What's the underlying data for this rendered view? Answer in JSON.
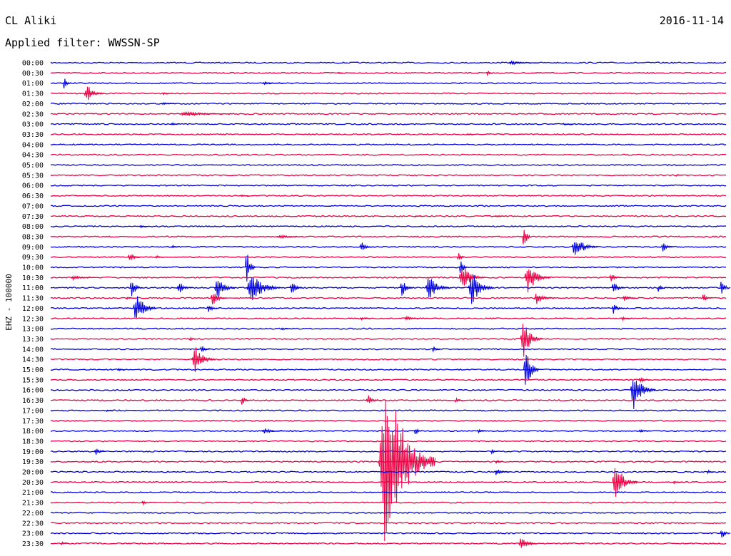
{
  "header": {
    "station": "CL Aliki",
    "date": "2016-11-14",
    "filter_label": "Applied filter: WWSSN-SP"
  },
  "chart_data": {
    "type": "line",
    "ylabel": "EHZ - 100000",
    "colors": [
      "#0000dd",
      "#ee0044"
    ],
    "x_range_minutes": [
      0,
      30
    ],
    "rows": [
      {
        "label": "00:00",
        "color": "blue",
        "events": [
          {
            "t": 20.5,
            "amp": 3,
            "dur": 1.2
          }
        ]
      },
      {
        "label": "00:30",
        "color": "red",
        "events": [
          {
            "t": 19.4,
            "amp": 6,
            "dur": 0.2
          },
          {
            "t": 12.8,
            "amp": 2,
            "dur": 0.2
          }
        ]
      },
      {
        "label": "01:00",
        "color": "blue",
        "events": [
          {
            "t": 0.6,
            "amp": 9,
            "dur": 0.3
          },
          {
            "t": 9.5,
            "amp": 3,
            "dur": 0.8
          }
        ]
      },
      {
        "label": "01:30",
        "color": "red",
        "events": [
          {
            "t": 1.6,
            "amp": 14,
            "dur": 0.8
          },
          {
            "t": 5.0,
            "amp": 2,
            "dur": 0.4
          }
        ]
      },
      {
        "label": "02:00",
        "color": "blue",
        "events": [
          {
            "t": 5.0,
            "amp": 2,
            "dur": 0.6
          }
        ]
      },
      {
        "label": "02:30",
        "color": "red",
        "events": [
          {
            "t": 6.0,
            "amp": 4,
            "dur": 2.0
          }
        ]
      },
      {
        "label": "03:00",
        "color": "blue",
        "events": [
          {
            "t": 5.4,
            "amp": 3,
            "dur": 0.3
          },
          {
            "t": 22.8,
            "amp": 2,
            "dur": 0.4
          }
        ]
      },
      {
        "label": "03:30",
        "color": "red",
        "events": [
          {
            "t": 18.5,
            "amp": 2,
            "dur": 0.3
          }
        ]
      },
      {
        "label": "04:00",
        "color": "blue",
        "events": []
      },
      {
        "label": "04:30",
        "color": "red",
        "events": []
      },
      {
        "label": "05:00",
        "color": "blue",
        "events": []
      },
      {
        "label": "05:30",
        "color": "red",
        "events": [
          {
            "t": 27.8,
            "amp": 2,
            "dur": 0.3
          }
        ]
      },
      {
        "label": "06:00",
        "color": "blue",
        "events": []
      },
      {
        "label": "06:30",
        "color": "red",
        "events": [
          {
            "t": 8.5,
            "amp": 2,
            "dur": 0.3
          }
        ]
      },
      {
        "label": "07:00",
        "color": "blue",
        "events": []
      },
      {
        "label": "07:30",
        "color": "red",
        "events": [
          {
            "t": 16.2,
            "amp": 2,
            "dur": 0.3
          },
          {
            "t": 19.8,
            "amp": 2,
            "dur": 0.4
          }
        ]
      },
      {
        "label": "08:00",
        "color": "blue",
        "events": [
          {
            "t": 4.0,
            "amp": 2,
            "dur": 0.4
          }
        ]
      },
      {
        "label": "08:30",
        "color": "red",
        "events": [
          {
            "t": 10.2,
            "amp": 3,
            "dur": 1.0
          },
          {
            "t": 21.0,
            "amp": 30,
            "dur": 0.3
          }
        ]
      },
      {
        "label": "09:00",
        "color": "blue",
        "events": [
          {
            "t": 5.4,
            "amp": 3,
            "dur": 0.3
          },
          {
            "t": 13.8,
            "amp": 8,
            "dur": 0.5
          },
          {
            "t": 23.3,
            "amp": 18,
            "dur": 1.0
          },
          {
            "t": 27.2,
            "amp": 8,
            "dur": 0.5
          }
        ]
      },
      {
        "label": "09:30",
        "color": "red",
        "events": [
          {
            "t": 3.5,
            "amp": 8,
            "dur": 0.5
          },
          {
            "t": 4.7,
            "amp": 3,
            "dur": 0.3
          },
          {
            "t": 18.1,
            "amp": 10,
            "dur": 0.3
          }
        ]
      },
      {
        "label": "10:00",
        "color": "blue",
        "events": [
          {
            "t": 8.7,
            "amp": 30,
            "dur": 0.4
          },
          {
            "t": 18.2,
            "amp": 20,
            "dur": 0.3
          }
        ]
      },
      {
        "label": "10:30",
        "color": "red",
        "events": [
          {
            "t": 1.0,
            "amp": 3,
            "dur": 1.0
          },
          {
            "t": 18.3,
            "amp": 22,
            "dur": 1.0
          },
          {
            "t": 21.2,
            "amp": 25,
            "dur": 1.0
          },
          {
            "t": 24.9,
            "amp": 8,
            "dur": 0.5
          }
        ]
      },
      {
        "label": "11:00",
        "color": "blue",
        "events": [
          {
            "t": 3.6,
            "amp": 14,
            "dur": 0.5
          },
          {
            "t": 5.7,
            "amp": 10,
            "dur": 0.6
          },
          {
            "t": 7.4,
            "amp": 18,
            "dur": 0.8
          },
          {
            "t": 8.9,
            "amp": 25,
            "dur": 1.3
          },
          {
            "t": 10.7,
            "amp": 12,
            "dur": 0.5
          },
          {
            "t": 15.6,
            "amp": 14,
            "dur": 0.5
          },
          {
            "t": 16.8,
            "amp": 18,
            "dur": 1.0
          },
          {
            "t": 18.7,
            "amp": 28,
            "dur": 1.0
          },
          {
            "t": 25.0,
            "amp": 10,
            "dur": 0.5
          },
          {
            "t": 27.0,
            "amp": 8,
            "dur": 0.3
          },
          {
            "t": 29.8,
            "amp": 14,
            "dur": 0.4
          }
        ]
      },
      {
        "label": "11:30",
        "color": "red",
        "events": [
          {
            "t": 3.4,
            "amp": 3,
            "dur": 0.3
          },
          {
            "t": 7.2,
            "amp": 12,
            "dur": 0.6
          },
          {
            "t": 21.6,
            "amp": 10,
            "dur": 0.8
          },
          {
            "t": 25.5,
            "amp": 6,
            "dur": 0.5
          },
          {
            "t": 29.0,
            "amp": 8,
            "dur": 0.4
          }
        ]
      },
      {
        "label": "12:00",
        "color": "blue",
        "events": [
          {
            "t": 3.8,
            "amp": 24,
            "dur": 0.9
          },
          {
            "t": 7.0,
            "amp": 10,
            "dur": 0.4
          },
          {
            "t": 25.0,
            "amp": 8,
            "dur": 0.5
          }
        ]
      },
      {
        "label": "12:30",
        "color": "red",
        "events": [
          {
            "t": 13.8,
            "amp": 3,
            "dur": 0.4
          },
          {
            "t": 15.8,
            "amp": 4,
            "dur": 0.6
          },
          {
            "t": 25.4,
            "amp": 4,
            "dur": 0.4
          }
        ]
      },
      {
        "label": "13:00",
        "color": "blue",
        "events": [
          {
            "t": 10.3,
            "amp": 3,
            "dur": 0.4
          }
        ]
      },
      {
        "label": "13:30",
        "color": "red",
        "events": [
          {
            "t": 6.2,
            "amp": 3,
            "dur": 0.3
          },
          {
            "t": 21.0,
            "amp": 28,
            "dur": 0.9
          }
        ]
      },
      {
        "label": "14:00",
        "color": "blue",
        "events": [
          {
            "t": 6.7,
            "amp": 6,
            "dur": 0.4
          },
          {
            "t": 17.0,
            "amp": 5,
            "dur": 0.3
          }
        ]
      },
      {
        "label": "14:30",
        "color": "red",
        "events": [
          {
            "t": 6.4,
            "amp": 22,
            "dur": 0.9
          }
        ]
      },
      {
        "label": "15:00",
        "color": "blue",
        "events": [
          {
            "t": 3.0,
            "amp": 3,
            "dur": 0.3
          },
          {
            "t": 21.1,
            "amp": 35,
            "dur": 0.6
          }
        ]
      },
      {
        "label": "15:30",
        "color": "red",
        "events": [
          {
            "t": 26.2,
            "amp": 5,
            "dur": 0.5
          }
        ]
      },
      {
        "label": "16:00",
        "color": "blue",
        "events": [
          {
            "t": 25.9,
            "amp": 30,
            "dur": 1.0
          }
        ]
      },
      {
        "label": "16:30",
        "color": "red",
        "events": [
          {
            "t": 8.5,
            "amp": 10,
            "dur": 0.3
          },
          {
            "t": 14.1,
            "amp": 8,
            "dur": 0.6
          },
          {
            "t": 18.0,
            "amp": 4,
            "dur": 0.3
          }
        ]
      },
      {
        "label": "17:00",
        "color": "blue",
        "events": [
          {
            "t": 2.5,
            "amp": 2,
            "dur": 0.3
          }
        ]
      },
      {
        "label": "17:30",
        "color": "red",
        "events": []
      },
      {
        "label": "18:00",
        "color": "blue",
        "events": [
          {
            "t": 9.5,
            "amp": 4,
            "dur": 0.8
          },
          {
            "t": 16.2,
            "amp": 8,
            "dur": 0.3
          },
          {
            "t": 19.0,
            "amp": 3,
            "dur": 0.4
          },
          {
            "t": 26.2,
            "amp": 3,
            "dur": 0.4
          }
        ]
      },
      {
        "label": "18:30",
        "color": "red",
        "events": []
      },
      {
        "label": "19:00",
        "color": "blue",
        "events": [
          {
            "t": 2.0,
            "amp": 6,
            "dur": 0.4
          },
          {
            "t": 19.6,
            "amp": 4,
            "dur": 0.3
          }
        ]
      },
      {
        "label": "19:30",
        "color": "red",
        "events": [
          {
            "t": 14.9,
            "amp": 140,
            "dur": 2.2
          },
          {
            "t": 19.8,
            "amp": 4,
            "dur": 0.3
          }
        ]
      },
      {
        "label": "20:00",
        "color": "blue",
        "events": [
          {
            "t": 19.8,
            "amp": 6,
            "dur": 0.6
          },
          {
            "t": 29.2,
            "amp": 3,
            "dur": 0.3
          }
        ]
      },
      {
        "label": "20:30",
        "color": "red",
        "events": [
          {
            "t": 25.1,
            "amp": 30,
            "dur": 1.0
          },
          {
            "t": 27.7,
            "amp": 3,
            "dur": 0.3
          }
        ]
      },
      {
        "label": "21:00",
        "color": "blue",
        "events": []
      },
      {
        "label": "21:30",
        "color": "red",
        "events": [
          {
            "t": 4.1,
            "amp": 4,
            "dur": 0.4
          }
        ]
      },
      {
        "label": "22:00",
        "color": "blue",
        "events": []
      },
      {
        "label": "22:30",
        "color": "red",
        "events": []
      },
      {
        "label": "23:00",
        "color": "blue",
        "events": [
          {
            "t": 29.8,
            "amp": 10,
            "dur": 0.4
          }
        ]
      },
      {
        "label": "23:30",
        "color": "red",
        "events": [
          {
            "t": 0.5,
            "amp": 3,
            "dur": 0.3
          },
          {
            "t": 20.9,
            "amp": 14,
            "dur": 0.7
          }
        ]
      }
    ]
  }
}
